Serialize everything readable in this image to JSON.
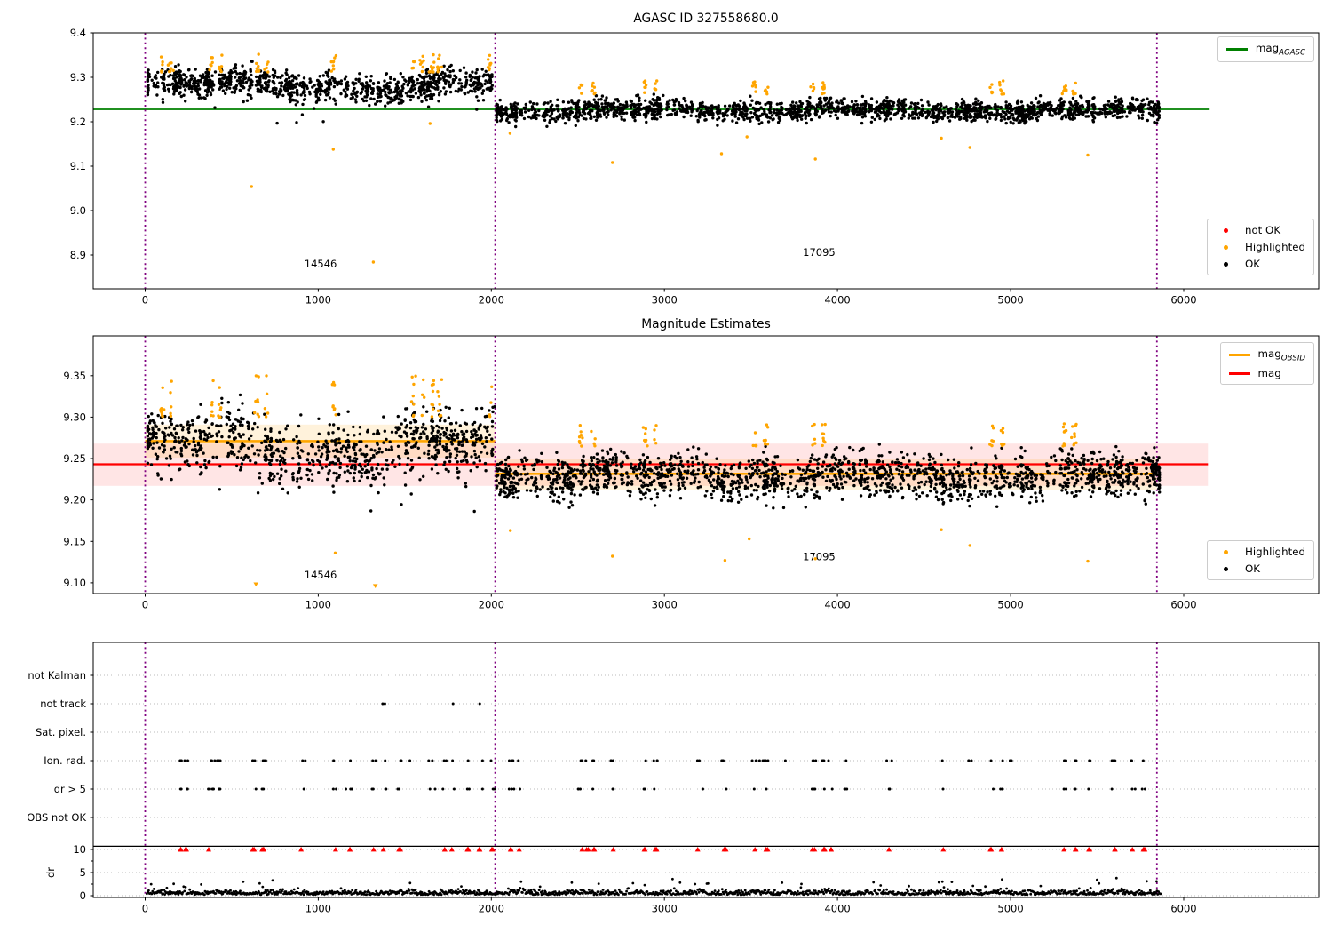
{
  "seed": 20240613,
  "colors": {
    "ok": "#000000",
    "highlight": "#FFA500",
    "not_ok": "#FF0000",
    "mag_agasc_line": "#008000",
    "mag_line": "#FF0000",
    "mag_obsid_line": "#FFA500",
    "vline": "#800080",
    "band_red": "rgba(255,0,0,0.10)",
    "band_orange": "rgba(255,165,0,0.14)",
    "grid": "#bbbbbb",
    "separator": "#000000",
    "spine": "#000000",
    "text": "#000000"
  },
  "chart_data": {
    "x_axis": {
      "xlim": [
        -300,
        6780
      ],
      "ticks": [
        0,
        1000,
        2000,
        3000,
        4000,
        5000,
        6000
      ],
      "tick_labels": [
        "0",
        "1000",
        "2000",
        "3000",
        "4000",
        "5000",
        "6000"
      ]
    },
    "vlines": [
      0,
      2022,
      5845
    ],
    "panels": [
      {
        "id": "mag_agasc",
        "type": "scatter",
        "title": "AGASC ID 327558680.0",
        "ylim": [
          8.824,
          9.4
        ],
        "yticks": {
          "values": [
            9.4,
            9.3,
            9.2,
            9.1,
            9.0,
            8.9
          ],
          "labels": [
            "9.4",
            "9.3",
            "9.2",
            "9.1",
            "9.0",
            "8.9"
          ]
        },
        "hline": {
          "y": 9.228,
          "x0": -300,
          "x1": 6150,
          "color": "mag_agasc_line"
        },
        "legends": {
          "line": {
            "items": [
              {
                "main": "mag",
                "sub": "AGASC",
                "color": "mag_agasc_line"
              }
            ]
          },
          "markers": {
            "items": [
              {
                "label": "not OK",
                "color": "not_ok"
              },
              {
                "label": "Highlighted",
                "color": "highlight"
              },
              {
                "label": "OK",
                "color": "ok"
              }
            ]
          }
        },
        "annotations": [
          {
            "text": "14546",
            "x": 920,
            "y": 8.872
          },
          {
            "text": "17095",
            "x": 3800,
            "y": 8.898
          }
        ],
        "segments": [
          {
            "x0": 15,
            "x1": 2020,
            "base": 9.282,
            "sigma": 0.016,
            "clip": [
              9.215,
              9.338
            ],
            "wave": [
              [
                0.011,
                260,
                0.0
              ],
              [
                0.006,
                90,
                1.3
              ]
            ],
            "rare_low": 0.012,
            "highlight_centers": [
              100,
              150,
              385,
              430,
              650,
              700,
              1090,
              1545,
              1600,
              1660,
              1700,
              1990
            ],
            "highlight_band": [
              9.312,
              9.352
            ]
          },
          {
            "x0": 2030,
            "x1": 5858,
            "base": 9.2255,
            "sigma": 0.0115,
            "clip": [
              9.188,
              9.262
            ],
            "wave": [
              [
                0.0045,
                210,
                0.5
              ],
              [
                0.003,
                70,
                2.1
              ]
            ],
            "rare_low": 0.0,
            "highlight_centers": [
              2520,
              2590,
              2890,
              2950,
              3520,
              3590,
              3862,
              3920,
              4890,
              4950,
              5312,
              5370
            ],
            "highlight_band": [
              9.262,
              9.292
            ]
          }
        ],
        "outliers": [
          {
            "x": 615,
            "y": 9.054
          },
          {
            "x": 1087,
            "y": 9.138
          },
          {
            "x": 1318,
            "y": 8.884
          },
          {
            "x": 1646,
            "y": 9.196
          },
          {
            "x": 2108,
            "y": 9.174
          },
          {
            "x": 2700,
            "y": 9.108
          },
          {
            "x": 3330,
            "y": 9.128
          },
          {
            "x": 3477,
            "y": 9.166
          },
          {
            "x": 3872,
            "y": 9.116
          },
          {
            "x": 4600,
            "y": 9.163
          },
          {
            "x": 4765,
            "y": 9.142
          },
          {
            "x": 5446,
            "y": 9.125
          }
        ]
      },
      {
        "id": "mag_estimates",
        "type": "scatter",
        "title": "Magnitude Estimates",
        "ylim": [
          9.087,
          9.398
        ],
        "yticks": {
          "values": [
            9.35,
            9.3,
            9.25,
            9.2,
            9.15,
            9.1
          ],
          "labels": [
            "9.35",
            "9.30",
            "9.25",
            "9.20",
            "9.15",
            "9.10"
          ]
        },
        "hline": {
          "y": 9.243,
          "x0": -300,
          "x1": 6140,
          "color": "mag_line"
        },
        "band_red": {
          "y0": 9.217,
          "y1": 9.268,
          "x0": -300,
          "x1": 6140
        },
        "obsid_segments": [
          {
            "x0": 0,
            "x1": 2022,
            "y": 9.271,
            "band": [
              9.251,
              9.291
            ]
          },
          {
            "x0": 2022,
            "x1": 5845,
            "y": 9.2315,
            "band": [
              9.212,
              9.25
            ]
          }
        ],
        "legends": {
          "line": {
            "items": [
              {
                "main": "mag",
                "sub": "OBSID",
                "color": "mag_obsid_line"
              },
              {
                "main": "mag",
                "sub": "",
                "color": "mag_line"
              }
            ]
          },
          "markers": {
            "items": [
              {
                "label": "Highlighted",
                "color": "highlight"
              },
              {
                "label": "OK",
                "color": "ok"
              }
            ]
          }
        },
        "annotations": [
          {
            "text": "14546",
            "x": 920,
            "y": 9.105
          },
          {
            "text": "17095",
            "x": 3800,
            "y": 9.127
          }
        ],
        "segments": [
          {
            "x0": 15,
            "x1": 2020,
            "base": 9.262,
            "sigma": 0.019,
            "clip": [
              9.208,
              9.328
            ],
            "wave": [
              [
                0.013,
                230,
                0.2
              ],
              [
                0.007,
                80,
                1.1
              ]
            ],
            "rare_low": 0.012,
            "highlight_centers": [
              100,
              150,
              385,
              430,
              650,
              700,
              1090,
              1545,
              1600,
              1660,
              1700,
              1990
            ],
            "highlight_band": [
              9.3,
              9.352
            ]
          },
          {
            "x0": 2030,
            "x1": 5860,
            "base": 9.2285,
            "sigma": 0.0135,
            "clip": [
              9.19,
              9.272
            ],
            "wave": [
              [
                0.0045,
                210,
                0.6
              ],
              [
                0.0035,
                72,
                2.0
              ]
            ],
            "rare_low": 0.0,
            "highlight_centers": [
              2520,
              2590,
              2890,
              2950,
              3520,
              3590,
              3862,
              3920,
              4890,
              4950,
              5312,
              5370
            ],
            "highlight_band": [
              9.265,
              9.292
            ]
          }
        ],
        "outliers": [
          {
            "x": 640,
            "y": 9.098,
            "m": "v"
          },
          {
            "x": 1098,
            "y": 9.136
          },
          {
            "x": 1330,
            "y": 9.096,
            "m": "v"
          },
          {
            "x": 2110,
            "y": 9.163
          },
          {
            "x": 2700,
            "y": 9.132
          },
          {
            "x": 3350,
            "y": 9.127
          },
          {
            "x": 3490,
            "y": 9.153
          },
          {
            "x": 3872,
            "y": 9.129
          },
          {
            "x": 4600,
            "y": 9.164
          },
          {
            "x": 4765,
            "y": 9.145
          },
          {
            "x": 5446,
            "y": 9.126
          }
        ]
      },
      {
        "id": "flags",
        "type": "flags",
        "rows": [
          "not Kalman",
          "not track",
          "Sat. pixel.",
          "Ion. rad.",
          "dr > 5",
          "OBS not OK"
        ],
        "dr_axis": {
          "label": "dr",
          "ticks": [
            10,
            5,
            0
          ],
          "tick_labels": [
            "10",
            "5",
            "0"
          ]
        },
        "separator_dr": 10.7,
        "not_track_x": [
          1372,
          1385,
          1779,
          1933
        ],
        "ion_rad_clusters": [
          205,
          240,
          372,
          398,
          425,
          630,
          680,
          905,
          1095,
          1180,
          1325,
          1382,
          1475,
          1540,
          1660,
          1730,
          1772,
          1870,
          1935,
          2000,
          2115,
          2165,
          2520,
          2555,
          2590,
          2700,
          2890,
          2950,
          3200,
          3350,
          3520,
          3560,
          3590,
          3700,
          3862,
          3920,
          3960,
          4050,
          4300,
          4600,
          4765,
          4890,
          4950,
          5000,
          5312,
          5370,
          5450,
          5600,
          5700,
          5770
        ],
        "dr5_clusters": [
          205,
          240,
          372,
          398,
          425,
          630,
          680,
          905,
          1095,
          1180,
          1325,
          1382,
          1475,
          1660,
          1730,
          1772,
          1870,
          1935,
          2000,
          2115,
          2165,
          2520,
          2590,
          2700,
          2890,
          2950,
          3200,
          3350,
          3520,
          3590,
          3862,
          3920,
          3960,
          4050,
          4300,
          4600,
          4890,
          4950,
          5312,
          5370,
          5450,
          5600,
          5700,
          5770
        ],
        "red_dr10_x": [
          205,
          235,
          369,
          626,
          677,
          905,
          1097,
          1180,
          1323,
          1379,
          1472,
          1728,
          1769,
          1867,
          1933,
          2000,
          2113,
          2164,
          2520,
          2555,
          2590,
          2700,
          2890,
          2950,
          3200,
          3350,
          3520,
          3590,
          3862,
          3920,
          3960,
          4300,
          4600,
          4890,
          4950,
          5312,
          5370,
          5450,
          5600,
          5700,
          5770
        ],
        "baseline": {
          "x0": 10,
          "x1": 5868,
          "max_dr": 4.0
        }
      }
    ]
  }
}
